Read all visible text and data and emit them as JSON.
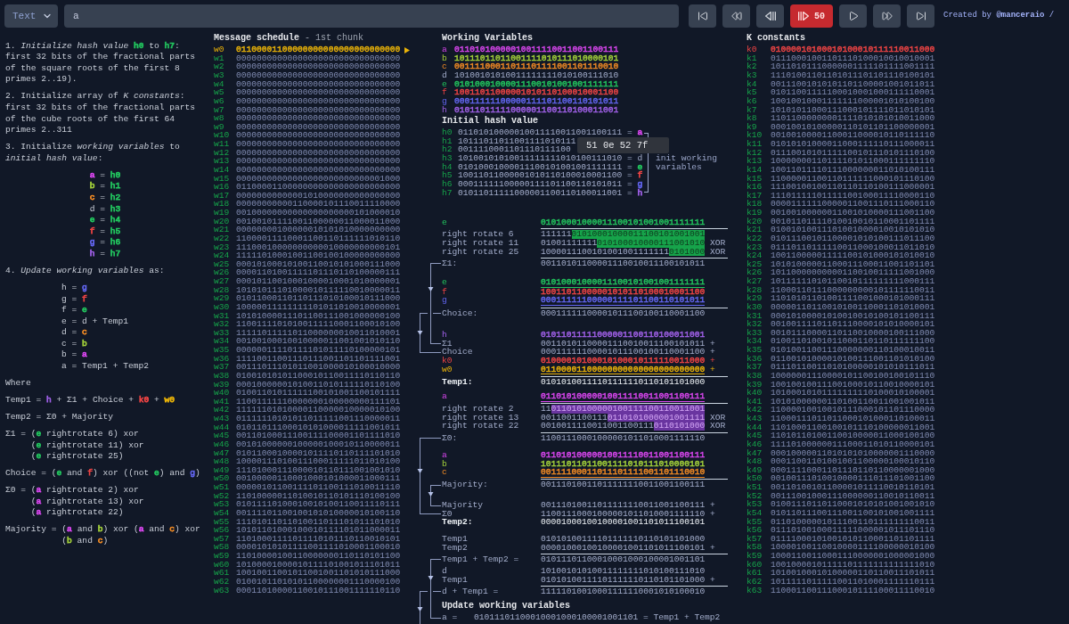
{
  "toolbar": {
    "mode": {
      "value": "Text"
    },
    "message": {
      "value": "a"
    },
    "controls": [
      {
        "kind": "first",
        "active": false
      },
      {
        "kind": "rewind",
        "active": false
      },
      {
        "kind": "step_back",
        "active": false
      },
      {
        "kind": "step_forward",
        "label": "50",
        "active": true
      },
      {
        "kind": "play",
        "active": false
      },
      {
        "kind": "fast_forward",
        "active": false
      },
      {
        "kind": "last",
        "active": false
      }
    ],
    "credit": "Created by **@manceraio** /"
  },
  "explanation": [
    {
      "kind": "paragraph",
      "runs": [
        {
          "text": "1. *Initialize hash value* "
        },
        {
          "text": "**h0**",
          "color": "#22c55e"
        },
        {
          "text": " to "
        },
        {
          "text": "**h7**",
          "color": "#22c55e"
        },
        {
          "text": ": first 32 bits of the fractional parts of the square roots of the first 8 primes 2..19)."
        }
      ]
    },
    {
      "kind": "paragraph",
      "runs": [
        {
          "text": "2. Initialize array of *K constants*: first 32 bits of the fractional parts of the cube roots of the first 64 primes 2..311"
        }
      ]
    },
    {
      "kind": "paragraph",
      "runs": [
        {
          "text": "3. Initialize *working variables* to *initial hash value*:"
        }
      ]
    },
    {
      "kind": "assignments",
      "rows": [
        {
          "runs": [
            {
              "text": "a",
              "color": "#d946ef"
            },
            {
              "text": " = "
            },
            {
              "text": "h0",
              "color": "#22c55e"
            }
          ]
        },
        {
          "runs": [
            {
              "text": "b",
              "color": "#a3d13a"
            },
            {
              "text": " = "
            },
            {
              "text": "h1",
              "color": "#22c55e"
            }
          ]
        },
        {
          "runs": [
            {
              "text": "c",
              "color": "#f08a24"
            },
            {
              "text": " = "
            },
            {
              "text": "h2",
              "color": "#22c55e"
            }
          ]
        },
        {
          "runs": [
            {
              "text": "d = "
            },
            {
              "text": "h3",
              "color": "#22c55e"
            }
          ]
        },
        {
          "runs": [
            {
              "text": "e",
              "color": "#22c55e"
            },
            {
              "text": " = "
            },
            {
              "text": "h4",
              "color": "#22c55e"
            }
          ]
        },
        {
          "runs": [
            {
              "text": "f",
              "color": "#ef4444"
            },
            {
              "text": " = "
            },
            {
              "text": "h5",
              "color": "#22c55e"
            }
          ]
        },
        {
          "runs": [
            {
              "text": "g",
              "color": "#6366f1"
            },
            {
              "text": " = "
            },
            {
              "text": "h6",
              "color": "#22c55e"
            }
          ]
        },
        {
          "runs": [
            {
              "text": "h",
              "color": "#a060e8"
            },
            {
              "text": " = "
            },
            {
              "text": "h7",
              "color": "#22c55e"
            }
          ]
        }
      ]
    },
    {
      "kind": "paragraph",
      "runs": [
        {
          "text": "4. *Update working variables* as:"
        }
      ]
    },
    {
      "kind": "assignments",
      "rows": [
        {
          "runs": [
            {
              "text": "h = "
            },
            {
              "text": "g",
              "color": "#6366f1"
            }
          ]
        },
        {
          "runs": [
            {
              "text": "g = "
            },
            {
              "text": "f",
              "color": "#ef4444"
            }
          ]
        },
        {
          "runs": [
            {
              "text": "f = "
            },
            {
              "text": "e",
              "color": "#22c55e"
            }
          ]
        },
        {
          "runs": [
            {
              "text": "e = d + Temp1"
            }
          ]
        },
        {
          "runs": [
            {
              "text": "d = "
            },
            {
              "text": "c",
              "color": "#f08a24"
            }
          ]
        },
        {
          "runs": [
            {
              "text": "c = "
            },
            {
              "text": "b",
              "color": "#a3d13a"
            }
          ]
        },
        {
          "runs": [
            {
              "text": "b = "
            },
            {
              "text": "a",
              "color": "#d946ef"
            }
          ]
        },
        {
          "runs": [
            {
              "text": "a = Temp1 + Temp2"
            }
          ]
        }
      ]
    },
    {
      "kind": "paragraph",
      "runs": [
        {
          "text": "Where"
        }
      ]
    },
    {
      "kind": "formula",
      "lines": [
        [
          {
            "text": "Temp1 = "
          },
          {
            "text": "h",
            "color": "#a060e8"
          },
          {
            "text": " + Σ1 + Choice + "
          },
          {
            "text": "k0",
            "color": "#ef4444"
          },
          {
            "text": " + "
          },
          {
            "text": "w0",
            "color": "#eab308"
          }
        ]
      ]
    },
    {
      "kind": "formula",
      "lines": [
        [
          {
            "text": "Temp2 = Σ0 + Majority"
          }
        ]
      ]
    },
    {
      "kind": "formula",
      "lines": [
        [
          {
            "text": "Σ1 = "
          },
          {
            "text": "("
          },
          {
            "text": "e",
            "color": "#22c55e"
          },
          {
            "text": " rightrotate 6) xor"
          }
        ],
        [
          {
            "text": "("
          },
          {
            "text": "e",
            "color": "#22c55e"
          },
          {
            "text": " rightrotate 11) xor"
          }
        ],
        [
          {
            "text": "("
          },
          {
            "text": "e",
            "color": "#22c55e"
          },
          {
            "text": " rightrotate 25)"
          }
        ]
      ]
    },
    {
      "kind": "formula",
      "lines": [
        [
          {
            "text": "Choice = ("
          },
          {
            "text": "e",
            "color": "#22c55e"
          },
          {
            "text": " and "
          },
          {
            "text": "f",
            "color": "#ef4444"
          },
          {
            "text": ") xor ((not "
          },
          {
            "text": "e",
            "color": "#22c55e"
          },
          {
            "text": ") and "
          },
          {
            "text": "g",
            "color": "#6366f1"
          },
          {
            "text": ")"
          }
        ]
      ]
    },
    {
      "kind": "formula",
      "lines": [
        [
          {
            "text": "Σ0 = "
          },
          {
            "text": "("
          },
          {
            "text": "a",
            "color": "#d946ef"
          },
          {
            "text": " rightrotate 2) xor"
          }
        ],
        [
          {
            "text": "("
          },
          {
            "text": "a",
            "color": "#d946ef"
          },
          {
            "text": " rightrotate 13) xor"
          }
        ],
        [
          {
            "text": "("
          },
          {
            "text": "a",
            "color": "#d946ef"
          },
          {
            "text": " rightrotate 22)"
          }
        ]
      ]
    },
    {
      "kind": "formula",
      "lines": [
        [
          {
            "text": "Majority = "
          },
          {
            "text": "("
          },
          {
            "text": "a",
            "color": "#d946ef"
          },
          {
            "text": " and "
          },
          {
            "text": "b",
            "color": "#a3d13a"
          },
          {
            "text": ") xor ("
          },
          {
            "text": "a",
            "color": "#d946ef"
          },
          {
            "text": " and "
          },
          {
            "text": "c",
            "color": "#f08a24"
          },
          {
            "text": ") xor"
          }
        ],
        [
          {
            "text": "("
          },
          {
            "text": "b",
            "color": "#a3d13a"
          },
          {
            "text": " and "
          },
          {
            "text": "c",
            "color": "#f08a24"
          },
          {
            "text": ")"
          }
        ]
      ]
    }
  ],
  "message_schedule": {
    "title": "Message schedule",
    "subtitle": "- 1st chunk",
    "words": [
      {
        "label": "w0",
        "value": "01100001100000000000000000000000",
        "selected": true
      },
      {
        "label": "w1",
        "value": "00000000000000000000000000000000",
        "selected": false
      },
      {
        "label": "w2",
        "value": "00000000000000000000000000000000",
        "selected": false
      },
      {
        "label": "w3",
        "value": "00000000000000000000000000000000",
        "selected": false
      },
      {
        "label": "w4",
        "value": "00000000000000000000000000000000",
        "selected": false
      },
      {
        "label": "w5",
        "value": "00000000000000000000000000000000",
        "selected": false
      },
      {
        "label": "w6",
        "value": "00000000000000000000000000000000",
        "selected": false
      },
      {
        "label": "w7",
        "value": "00000000000000000000000000000000",
        "selected": false
      },
      {
        "label": "w8",
        "value": "00000000000000000000000000000000",
        "selected": false
      },
      {
        "label": "w9",
        "value": "00000000000000000000000000000000",
        "selected": false
      },
      {
        "label": "w10",
        "value": "00000000000000000000000000000000",
        "selected": false
      },
      {
        "label": "w11",
        "value": "00000000000000000000000000000000",
        "selected": false
      },
      {
        "label": "w12",
        "value": "00000000000000000000000000000000",
        "selected": false
      },
      {
        "label": "w13",
        "value": "00000000000000000000000000000000",
        "selected": false
      },
      {
        "label": "w14",
        "value": "00000000000000000000000000000000",
        "selected": false
      },
      {
        "label": "w15",
        "value": "00000000000000000000000000001000",
        "selected": false
      },
      {
        "label": "w16",
        "value": "01100001100000000000000000000000",
        "selected": false
      },
      {
        "label": "w17",
        "value": "00000000000001010000000000000000",
        "selected": false
      },
      {
        "label": "w18",
        "value": "00000000000110000101110011110000",
        "selected": false
      },
      {
        "label": "w19",
        "value": "00100000000000000000000101000010",
        "selected": false
      },
      {
        "label": "w20",
        "value": "00100101111001100000011000011000",
        "selected": false
      },
      {
        "label": "w21",
        "value": "00000000100000010101010000000000",
        "selected": false
      },
      {
        "label": "w22",
        "value": "11000011110001100110111111010110",
        "selected": false
      },
      {
        "label": "w23",
        "value": "11100010000000000010000000000101",
        "selected": false
      },
      {
        "label": "w24",
        "value": "11111010001001100100100000000000",
        "selected": false
      },
      {
        "label": "w25",
        "value": "00010100010100110010101000111000",
        "selected": false
      },
      {
        "label": "w26",
        "value": "00001101001111101110110100000111",
        "selected": false
      },
      {
        "label": "w27",
        "value": "00010110010001000010001010000001",
        "selected": false
      },
      {
        "label": "w28",
        "value": "10101011101000010111110010000011",
        "selected": false
      },
      {
        "label": "w29",
        "value": "01011000110110111010100010111000",
        "selected": false
      },
      {
        "label": "w30",
        "value": "10000011111111101011010010000001",
        "selected": false
      },
      {
        "label": "w31",
        "value": "10101000011101100111001000000100",
        "selected": false
      },
      {
        "label": "w32",
        "value": "11001111010100111110001100010100",
        "selected": false
      },
      {
        "label": "w33",
        "value": "11111011111011000000010011010001",
        "selected": false
      },
      {
        "label": "w34",
        "value": "00100100010010000011001001010110",
        "selected": false
      },
      {
        "label": "w35",
        "value": "00000011110111101011110100000101",
        "selected": false
      },
      {
        "label": "w36",
        "value": "11110011001110111001101101111001",
        "selected": false
      },
      {
        "label": "w37",
        "value": "00111011101011001000010100010000",
        "selected": false
      },
      {
        "label": "w38",
        "value": "01001010101100010110011110110110",
        "selected": false
      },
      {
        "label": "w39",
        "value": "00010000001010011010111110110100",
        "selected": false
      },
      {
        "label": "w40",
        "value": "01001101011111100101001100101111",
        "selected": false
      },
      {
        "label": "w41",
        "value": "11001111110000000100000000111101",
        "selected": false
      },
      {
        "label": "w42",
        "value": "11111101010000110000010000010100",
        "selected": false
      },
      {
        "label": "w43",
        "value": "01111110101011011111001110000011",
        "selected": false
      },
      {
        "label": "w44",
        "value": "01011011100010101000011111001011",
        "selected": false
      },
      {
        "label": "w45",
        "value": "00110100011100111100001101111010",
        "selected": false
      },
      {
        "label": "w46",
        "value": "00101000000100000100010110000011",
        "selected": false
      },
      {
        "label": "w47",
        "value": "01011000100001011110110111101010",
        "selected": false
      },
      {
        "label": "w48",
        "value": "10000111010011100011111011010100",
        "selected": false
      },
      {
        "label": "w49",
        "value": "11101000111000010110111001001010",
        "selected": false
      },
      {
        "label": "w50",
        "value": "00100000110001000101000011000111",
        "selected": false
      },
      {
        "label": "w51",
        "value": "00000101100111101100111010011110",
        "selected": false
      },
      {
        "label": "w52",
        "value": "11010000011010010110101110100100",
        "selected": false
      },
      {
        "label": "w53",
        "value": "01011110100010010100110011110111",
        "selected": false
      },
      {
        "label": "w54",
        "value": "00111101100100101010000010100110",
        "selected": false
      },
      {
        "label": "w55",
        "value": "11101011011010011011101011101010",
        "selected": false
      },
      {
        "label": "w56",
        "value": "10101101000100010111101011000011",
        "selected": false
      },
      {
        "label": "w57",
        "value": "11010001111011110101110110010101",
        "selected": false
      },
      {
        "label": "w58",
        "value": "00001010101111001111010001100010",
        "selected": false
      },
      {
        "label": "w59",
        "value": "11010000100110000000110110101100",
        "selected": false
      },
      {
        "label": "w60",
        "value": "10100001000010111101001011101011",
        "selected": false
      },
      {
        "label": "w61",
        "value": "10010011001011001001101010111000",
        "selected": false
      },
      {
        "label": "w62",
        "value": "01001011010101100000001110000100",
        "selected": false
      },
      {
        "label": "w63",
        "value": "00011010000110010111001111110110",
        "selected": false
      }
    ]
  },
  "working_variables": {
    "title": "Working Variables",
    "rows": [
      {
        "label": "a",
        "value": "01101010000010011110011001100111",
        "color": "#d946ef"
      },
      {
        "label": "b",
        "value": "10111011011001111010111010000101",
        "color": "#a3d13a"
      },
      {
        "label": "c",
        "value": "00111100011011101111001101110010",
        "color": "#f08a24"
      },
      {
        "label": "d",
        "value": "10100101010011111111010100111010"
      },
      {
        "label": "e",
        "value": "01010001000011100101001001111111",
        "color": "#22c55e"
      },
      {
        "label": "f",
        "value": "10011011000001010110100010001100",
        "color": "#ef4444"
      },
      {
        "label": "g",
        "value": "00011111100000111101100110101011",
        "color": "#6366f1"
      },
      {
        "label": "h",
        "value": "01011011111000001100110100011001",
        "color": "#a060e8"
      }
    ]
  },
  "initial_hash": {
    "title": "Initial hash value",
    "rows": [
      {
        "label": "h0",
        "value": "01101010000010011110011001100111",
        "eq": "=",
        "target": "a",
        "color": "#d946ef"
      },
      {
        "label": "h1",
        "value": "10111011011001111010111"
      },
      {
        "label": "h2",
        "value": "0011110001101110111100"
      },
      {
        "label": "h3",
        "value": "10100101010011111111010100111010",
        "eq": "=",
        "target": "d"
      },
      {
        "label": "h4",
        "value": "01010001000011100101001001111111",
        "eq": "=",
        "target": "e",
        "color": "#22c55e"
      },
      {
        "label": "h5",
        "value": "10011011000001010110100010001100",
        "eq": "=",
        "target": "f",
        "color": "#ef4444"
      },
      {
        "label": "h6",
        "value": "00011111100000111101100110101011",
        "eq": "=",
        "target": "g",
        "color": "#6366f1"
      },
      {
        "label": "h7",
        "value": "01011011111000001100110100011001",
        "eq": "=",
        "target": "h",
        "color": "#a060e8"
      }
    ],
    "bracket_label": "init working variables",
    "tooltip": "51 0e 52 7f"
  },
  "computation": {
    "blocks": [
      {
        "rows": [
          {
            "kind": "value",
            "label": "e",
            "value": "01010001000011100101001001111111",
            "color": "#22c55e",
            "rule": true
          },
          {
            "kind": "rotate",
            "label": "right rotate 6",
            "parts": [
              {
                "text": "111111",
                "highlighted": false
              },
              {
                "text": "01010001000011100101001001",
                "highlighted": true
              }
            ],
            "color": "#16a34a"
          },
          {
            "kind": "rotate",
            "label": "right rotate 11",
            "parts": [
              {
                "text": "01001111111",
                "highlighted": false
              },
              {
                "text": "010100010000111001010",
                "highlighted": true
              }
            ],
            "op": "XOR",
            "color": "#16a34a"
          },
          {
            "kind": "rotate",
            "label": "right rotate 25",
            "parts": [
              {
                "text": "1000011100101001001111111",
                "highlighted": false
              },
              {
                "text": "0101000",
                "highlighted": true
              }
            ],
            "op": "XOR",
            "color": "#16a34a",
            "rule": true
          },
          {
            "kind": "value",
            "label": "Σ1:",
            "value": "00110101100001110010011100101011"
          }
        ]
      },
      {
        "rows": [
          {
            "kind": "value",
            "label": "e",
            "value": "01010001000011100101001001111111",
            "color": "#22c55e",
            "underline": true
          },
          {
            "kind": "value",
            "label": "f",
            "value": "10011011000001010110100010001100",
            "color": "#ef4444"
          },
          {
            "kind": "value",
            "label": "g",
            "value": "00011111100000111101100110101011",
            "color": "#6366f1",
            "underline": true,
            "rule": true
          },
          {
            "kind": "value",
            "label": "Choice:",
            "value": "00011111100001011100100110001100"
          }
        ]
      },
      {
        "rows": [
          {
            "kind": "value",
            "label": "h",
            "value": "01011011111000001100110100011001",
            "color": "#a060e8"
          },
          {
            "kind": "value",
            "label": "Σ1",
            "value": "00110101100001110010011100101011",
            "op": "+"
          },
          {
            "kind": "value",
            "label": "Choice",
            "value": "00011111100001011100100110001100",
            "op": "+"
          },
          {
            "kind": "value",
            "label": "k0",
            "value": "01000010100010100010111110011000",
            "op": "+",
            "color": "#ef4444"
          },
          {
            "kind": "value",
            "label": "w0",
            "value": "01100001100000000000000000000000",
            "op": "+",
            "color": "#eab308",
            "underline": true,
            "rule": true
          },
          {
            "kind": "total",
            "label": "Temp1:",
            "value": "01010100111101111110110101101000"
          }
        ]
      },
      {
        "rows": [
          {
            "kind": "value",
            "label": "a",
            "value": "01101010000010011110011001100111",
            "color": "#d946ef",
            "underline": true,
            "rule": true
          },
          {
            "kind": "rotate",
            "label": "right rotate 2",
            "parts": [
              {
                "text": "11",
                "highlighted": false
              },
              {
                "text": "011010100000100111100110011001",
                "highlighted": true
              }
            ],
            "color": "#6a35a0"
          },
          {
            "kind": "rotate",
            "label": "right rotate 13",
            "parts": [
              {
                "text": "0011001100111",
                "highlighted": false
              },
              {
                "text": "0110101000001001111",
                "highlighted": true
              }
            ],
            "op": "XOR",
            "color": "#6a35a0"
          },
          {
            "kind": "rotate",
            "label": "right rotate 22",
            "parts": [
              {
                "text": "0010011110011001100111",
                "highlighted": false
              },
              {
                "text": "0110101000",
                "highlighted": true
              }
            ],
            "op": "XOR",
            "color": "#6a35a0",
            "rule": true
          },
          {
            "kind": "value",
            "label": "Σ0:",
            "value": "11001110001000001011010001111110"
          }
        ]
      },
      {
        "rows": [
          {
            "kind": "value",
            "label": "a",
            "value": "01101010000010011110011001100111",
            "color": "#d946ef"
          },
          {
            "kind": "value",
            "label": "b",
            "value": "10111011011001111010111010000101",
            "color": "#a3d13a"
          },
          {
            "kind": "value",
            "label": "c",
            "value": "00111100011011101111001101110010",
            "color": "#f08a24",
            "underline": true,
            "rule": true
          },
          {
            "kind": "value",
            "label": "Majority:",
            "value": "00111010011011111110011001100111"
          }
        ]
      },
      {
        "rows": [
          {
            "kind": "value",
            "label": "Majority",
            "value": "00111010011011111110011001100111",
            "op": "+"
          },
          {
            "kind": "value",
            "label": "Σ0",
            "value": "11001110001000001011010001111110",
            "op": "+"
          },
          {
            "kind": "total",
            "label": "Temp2:",
            "value": "00001000100100001001101011100101"
          }
        ]
      },
      {
        "rows": [
          {
            "kind": "value",
            "label": "Temp1",
            "value": "01010100111101111110110101101000"
          },
          {
            "kind": "value",
            "label": "Temp2",
            "value": "00001000100100001001101011100101",
            "op": "+",
            "rule": true
          },
          {
            "kind": "value",
            "label": "Temp1 + Temp2 =",
            "value": "01011101100010001000100001001101"
          }
        ]
      },
      {
        "rows": [
          {
            "kind": "value",
            "label": "d",
            "value": "10100101010011111111010100111010"
          },
          {
            "kind": "value",
            "label": "Temp1",
            "value": "01010100111101111110110101101000",
            "op": "+",
            "rule": true
          },
          {
            "kind": "value",
            "label": "d + Temp1 =",
            "value": "11111010010001111110001010100010"
          }
        ]
      }
    ]
  },
  "update": {
    "title": "Update working variables",
    "rows": [
      {
        "label": "a =",
        "value": "01011101100010001000100001001101",
        "note": "= Temp1 + Temp2"
      }
    ]
  },
  "k_constants": {
    "title": "K constants",
    "rows": [
      {
        "label": "k0",
        "value": "01000010100010100010111110011000",
        "selected": true
      },
      {
        "label": "k1",
        "value": "01110001001101110100010010010001",
        "selected": false
      },
      {
        "label": "k2",
        "value": "10110101110000001111101111001111",
        "selected": false
      },
      {
        "label": "k3",
        "value": "11101001101101011101101110100101",
        "selected": false
      },
      {
        "label": "k4",
        "value": "00111001010101101100001001011011",
        "selected": false
      },
      {
        "label": "k5",
        "value": "01011001111100010001000111110001",
        "selected": false
      },
      {
        "label": "k6",
        "value": "10010010001111111000001010100100",
        "selected": false
      },
      {
        "label": "k7",
        "value": "10101011000111000101111011010101",
        "selected": false
      },
      {
        "label": "k8",
        "value": "11011000000001111010101010011000",
        "selected": false
      },
      {
        "label": "k9",
        "value": "00010010100000110101101100000001",
        "selected": false
      },
      {
        "label": "k10",
        "value": "00100100001100011000010110111110",
        "selected": false
      },
      {
        "label": "k11",
        "value": "01010101000011000111110111000011",
        "selected": false
      },
      {
        "label": "k12",
        "value": "01110010101111100101110101110100",
        "selected": false
      },
      {
        "label": "k13",
        "value": "10000000110111101011000111111110",
        "selected": false
      },
      {
        "label": "k14",
        "value": "10011011110111000000011010100111",
        "selected": false
      },
      {
        "label": "k15",
        "value": "11000001100110111111000101110100",
        "selected": false
      },
      {
        "label": "k16",
        "value": "11100100100110110110100111000001",
        "selected": false
      },
      {
        "label": "k17",
        "value": "11101111101111100100011110000110",
        "selected": false
      },
      {
        "label": "k18",
        "value": "00001111110000011001110111000110",
        "selected": false
      },
      {
        "label": "k19",
        "value": "00100100000011001010000111001100",
        "selected": false
      },
      {
        "label": "k20",
        "value": "00101101111010010010110001101111",
        "selected": false
      },
      {
        "label": "k21",
        "value": "01001010011101001000010010101010",
        "selected": false
      },
      {
        "label": "k22",
        "value": "01011100101100001010100111011100",
        "selected": false
      },
      {
        "label": "k23",
        "value": "01110110111110011000100011011010",
        "selected": false
      },
      {
        "label": "k24",
        "value": "10011000001111100101000101010010",
        "selected": false
      },
      {
        "label": "k25",
        "value": "10101000001100011100011001101101",
        "selected": false
      },
      {
        "label": "k26",
        "value": "10110000000000110010011111001000",
        "selected": false
      },
      {
        "label": "k27",
        "value": "10111111010110010111111111000111",
        "selected": false
      },
      {
        "label": "k28",
        "value": "11000110111000000000101111110011",
        "selected": false
      },
      {
        "label": "k29",
        "value": "11010101101001111001000101000111",
        "selected": false
      },
      {
        "label": "k30",
        "value": "00000110110010100110001101010001",
        "selected": false
      },
      {
        "label": "k31",
        "value": "00010100001010010010100101100111",
        "selected": false
      },
      {
        "label": "k32",
        "value": "00100111101101110000101010000101",
        "selected": false
      },
      {
        "label": "k33",
        "value": "00101110000110110010000100111000",
        "selected": false
      },
      {
        "label": "k34",
        "value": "01001101001011000110110111111100",
        "selected": false
      },
      {
        "label": "k35",
        "value": "01010011001110000000110100010011",
        "selected": false
      },
      {
        "label": "k36",
        "value": "01100101000010100111001101010100",
        "selected": false
      },
      {
        "label": "k37",
        "value": "01110110011010100000101010111011",
        "selected": false
      },
      {
        "label": "k38",
        "value": "10000001110000101100100100101110",
        "selected": false
      },
      {
        "label": "k39",
        "value": "10010010011100100010110010000101",
        "selected": false
      },
      {
        "label": "k40",
        "value": "10100010101111111110100010100001",
        "selected": false
      },
      {
        "label": "k41",
        "value": "10101000000110100110011001001011",
        "selected": false
      },
      {
        "label": "k42",
        "value": "11000010010010111000101101110000",
        "selected": false
      },
      {
        "label": "k43",
        "value": "11000111011011000101000110100011",
        "selected": false
      },
      {
        "label": "k44",
        "value": "11010001100100101110100000011001",
        "selected": false
      },
      {
        "label": "k45",
        "value": "11010110100110010000011000100100",
        "selected": false
      },
      {
        "label": "k46",
        "value": "11110100000011100011010110000101",
        "selected": false
      },
      {
        "label": "k47",
        "value": "00010000011010101010000001110000",
        "selected": false
      },
      {
        "label": "k48",
        "value": "00011001101001001100000100010110",
        "selected": false
      },
      {
        "label": "k49",
        "value": "00011110001101110110110000001000",
        "selected": false
      },
      {
        "label": "k50",
        "value": "00100111010010000111011101001100",
        "selected": false
      },
      {
        "label": "k51",
        "value": "00110100101100001011110010110101",
        "selected": false
      },
      {
        "label": "k52",
        "value": "00111001000111000000110010110011",
        "selected": false
      },
      {
        "label": "k53",
        "value": "01001110110110001010101001001010",
        "selected": false
      },
      {
        "label": "k54",
        "value": "01011011100111001100101001001111",
        "selected": false
      },
      {
        "label": "k55",
        "value": "01101000001011100110111111110011",
        "selected": false
      },
      {
        "label": "k56",
        "value": "01110100100011111000001011101110",
        "selected": false
      },
      {
        "label": "k57",
        "value": "01111000101001010110001101101111",
        "selected": false
      },
      {
        "label": "k58",
        "value": "10000100110010000111100000010100",
        "selected": false
      },
      {
        "label": "k59",
        "value": "10001100110001110000001000001000",
        "selected": false
      },
      {
        "label": "k60",
        "value": "10010000101111101111111111111010",
        "selected": false
      },
      {
        "label": "k61",
        "value": "10100100010100000110110011101011",
        "selected": false
      },
      {
        "label": "k62",
        "value": "10111110111110011010001111110111",
        "selected": false
      },
      {
        "label": "k63",
        "value": "11000110011100010111100011110010",
        "selected": false
      }
    ]
  }
}
